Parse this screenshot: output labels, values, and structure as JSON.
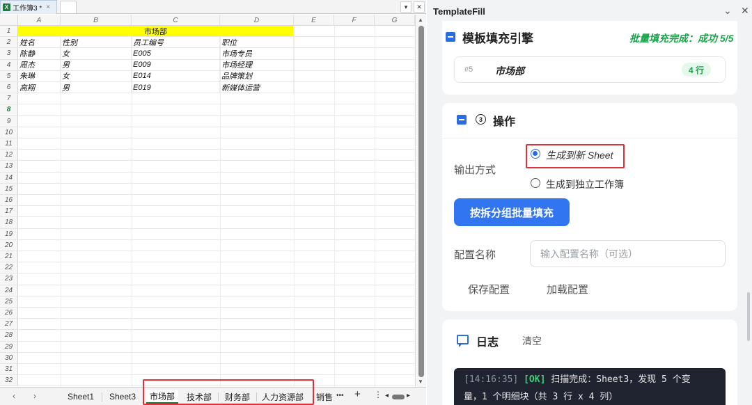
{
  "workbook": {
    "tab_label": "工作簿3 *",
    "tab_close": "×",
    "xl_badge": "X",
    "ctrl_dropdown": "▾",
    "ctrl_close": "✕"
  },
  "spreadsheet": {
    "columns": [
      "A",
      "B",
      "C",
      "D",
      "E",
      "F",
      "G"
    ],
    "merged_header": "市场部",
    "headers": [
      "姓名",
      "性别",
      "员工编号",
      "职位"
    ],
    "rows": [
      [
        "陈静",
        "女",
        "E005",
        "市场专员"
      ],
      [
        "周杰",
        "男",
        "E009",
        "市场经理"
      ],
      [
        "朱琳",
        "女",
        "E014",
        "品牌策划"
      ],
      [
        "高翔",
        "男",
        "E019",
        "新媒体运营"
      ]
    ],
    "row_numbers": [
      "1",
      "2",
      "3",
      "4",
      "5",
      "6",
      "7",
      "8",
      "9",
      "10",
      "11",
      "12",
      "13",
      "14",
      "15",
      "16",
      "17",
      "18",
      "19",
      "20",
      "21",
      "22",
      "23",
      "24",
      "25",
      "26",
      "27",
      "28",
      "29",
      "30",
      "31",
      "32"
    ],
    "selected_row": "8",
    "colors": {
      "header_fill": "#ffff00",
      "active_green": "#1a7a3a"
    }
  },
  "sheet_tabs": {
    "prev": "‹",
    "next": "›",
    "items": [
      "Sheet1",
      "Sheet3",
      "市场部",
      "技术部",
      "财务部",
      "人力资源部",
      "销售"
    ],
    "active": "市场部",
    "more": "•••",
    "add": "+",
    "menu": "⋮",
    "scroll_left": "◂",
    "scroll_right": "▸"
  },
  "panel": {
    "title": "TemplateFill",
    "ctl_collapse": "⌄",
    "ctl_close": "✕",
    "engine": {
      "title": "模板填充引擎",
      "status": "批量填充完成：成功 5/5"
    },
    "group": {
      "index": "#5",
      "name": "市场部",
      "badge": "4 行"
    },
    "ops": {
      "step": "3",
      "title": "操作",
      "output_label": "输出方式",
      "option_new_sheet": "生成到新 Sheet",
      "option_new_workbook": "生成到独立工作簿",
      "primary_button": "按拆分组批量填充",
      "config_label": "配置名称",
      "config_placeholder": "输入配置名称（可选）",
      "save_config": "保存配置",
      "load_config": "加载配置"
    },
    "log": {
      "title": "日志",
      "clear": "清空",
      "time": "[14:16:35]",
      "tag": "[OK]",
      "line1": "扫描完成：Sheet3，发现 5 个变",
      "line2": "量，1 个明细块（共 3 行 x 4 列）"
    },
    "colors": {
      "accent": "#3275f0",
      "success": "#1aa34a",
      "highlight_box": "#e0303a"
    }
  }
}
